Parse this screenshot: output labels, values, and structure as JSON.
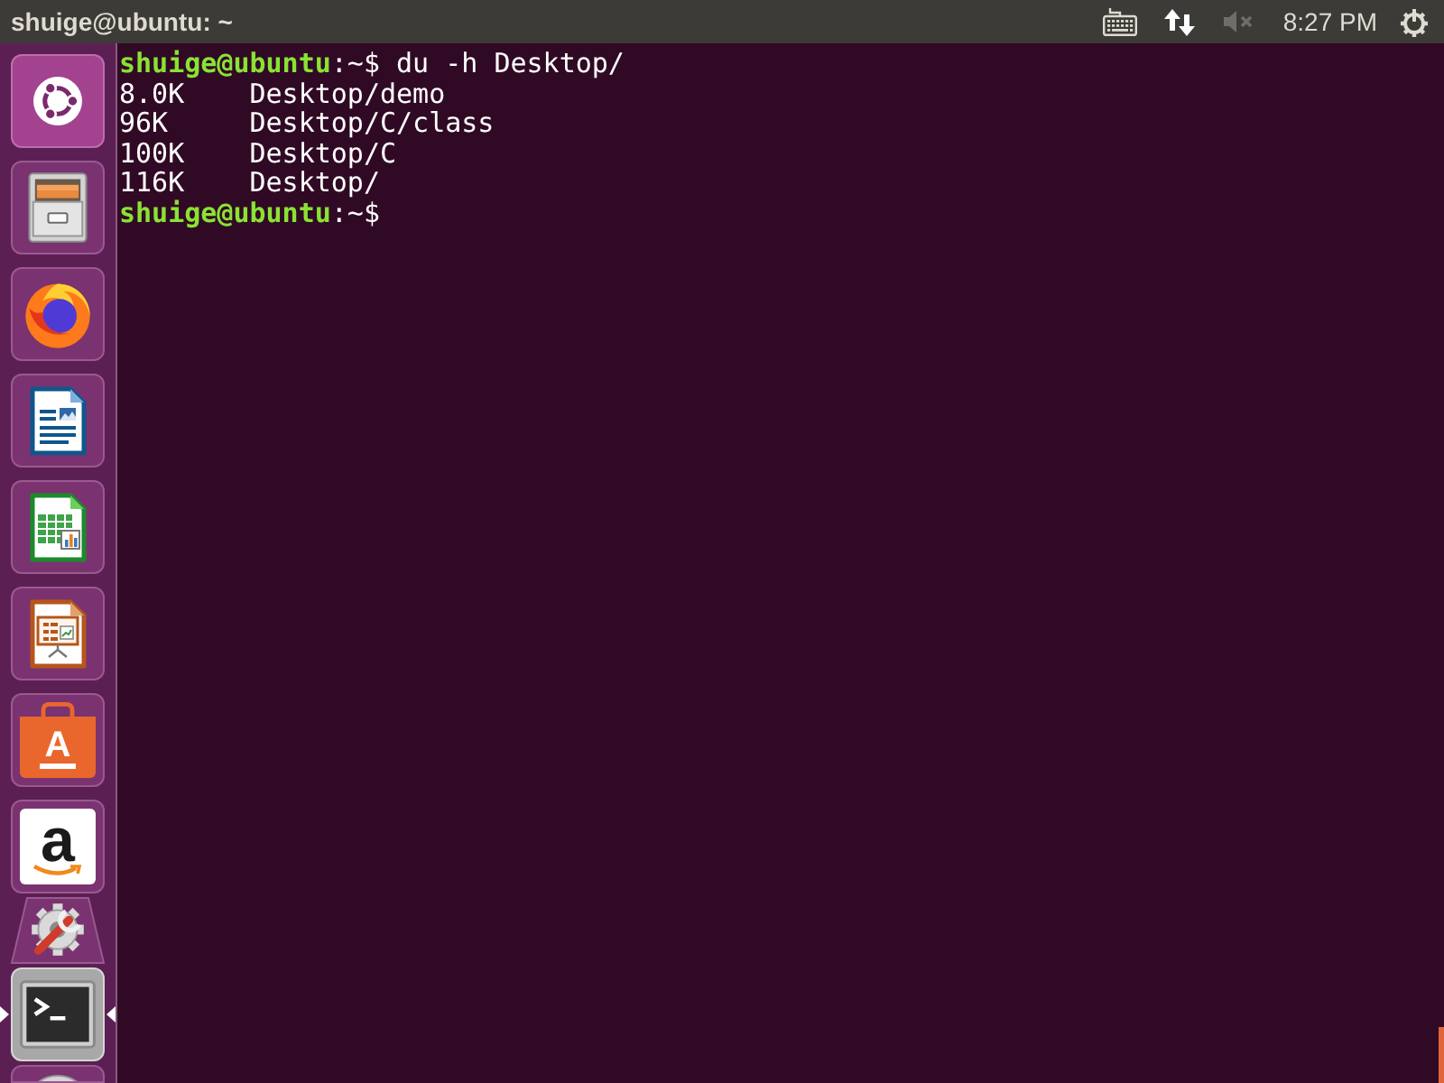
{
  "top_panel": {
    "window_title": "shuige@ubuntu: ~",
    "indicators": [
      {
        "kind": "keyboard"
      },
      {
        "kind": "network"
      },
      {
        "kind": "sound",
        "muted": true
      }
    ],
    "clock": "8:27 PM"
  },
  "launcher": {
    "items": [
      {
        "kind": "dash",
        "running": false,
        "focused": false,
        "folded": false
      },
      {
        "kind": "files",
        "running": false,
        "focused": false,
        "folded": false
      },
      {
        "kind": "firefox",
        "running": false,
        "focused": false,
        "folded": false
      },
      {
        "kind": "writer",
        "running": false,
        "focused": false,
        "folded": false
      },
      {
        "kind": "calc",
        "running": false,
        "focused": false,
        "folded": false
      },
      {
        "kind": "impress",
        "running": false,
        "focused": false,
        "folded": false
      },
      {
        "kind": "software",
        "label": "A",
        "running": false,
        "focused": false,
        "folded": false
      },
      {
        "kind": "amazon",
        "label": "a",
        "running": false,
        "focused": false,
        "folded": false
      },
      {
        "kind": "settings",
        "running": false,
        "focused": false,
        "folded": true
      },
      {
        "kind": "terminal",
        "running": true,
        "focused": true,
        "folded": false
      },
      {
        "kind": "dvd",
        "running": false,
        "focused": false,
        "folded": false
      }
    ]
  },
  "terminal": {
    "lines": [
      {
        "kind": "prompt",
        "user_host": "shuige@ubuntu",
        "location": ":~$",
        "command": "du -h Desktop/"
      },
      {
        "kind": "output",
        "size": "8.0K",
        "path": "Desktop/demo"
      },
      {
        "kind": "output",
        "size": "96K",
        "path": "Desktop/C/class"
      },
      {
        "kind": "output",
        "size": "100K",
        "path": "Desktop/C"
      },
      {
        "kind": "output",
        "size": "116K",
        "path": "Desktop/"
      },
      {
        "kind": "prompt",
        "user_host": "shuige@ubuntu",
        "location": ":~$"
      }
    ]
  }
}
